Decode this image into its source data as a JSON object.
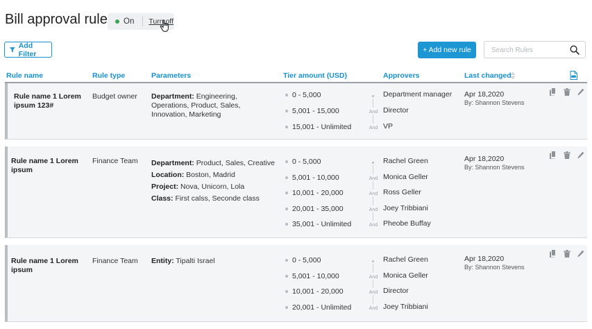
{
  "page": {
    "title": "Bill approval rules",
    "toggle": {
      "on_label": "On",
      "off_label": "Turn off",
      "status_color": "#3aa655"
    },
    "add_filter_label": "Add Filter",
    "add_rule_label": "+ Add new rule",
    "search_placeholder": "Search Rules"
  },
  "columns": {
    "rule_name": "Rule name",
    "rule_type": "Rule type",
    "parameters": "Parameters",
    "tier_amount": "Tier amount (USD)",
    "approvers": "Approvers",
    "last_changed": "Last changed"
  },
  "rules": [
    {
      "name": "Rule name 1 Lorem ipsum 123#",
      "type": "Budget owner",
      "params": [
        {
          "label": "Department:",
          "value": "Engineering, Operations, Product, Sales, Innovation, Marketing"
        }
      ],
      "tiers": [
        "0 - 5,000",
        "5,001 - 15,000",
        "15,001 - Unlimited"
      ],
      "approvers": [
        "Department manager",
        "Director",
        "VP"
      ],
      "date": "Apr 18,2020",
      "by": "By: Shannon Stevens"
    },
    {
      "name": "Rule name 1 Lorem ipsum",
      "type": "Finance Team",
      "params": [
        {
          "label": "Department:",
          "value": "Product, Sales, Creative"
        },
        {
          "label": "Location:",
          "value": "Boston, Madrid"
        },
        {
          "label": "Project:",
          "value": "Nova, Unicorn, Lola"
        },
        {
          "label": "Class:",
          "value": "First calss, Seconde class"
        }
      ],
      "tiers": [
        "0 - 5,000",
        "5,001 - 10,000",
        "10,001 - 20,000",
        "20,001 - 35,000",
        "35,001 - Unlimited"
      ],
      "approvers": [
        "Rachel Green",
        "Monica Geller",
        "Ross Geller",
        "Joey Tribbiani",
        "Pheobe Buffay"
      ],
      "date": "Apr 18,2020",
      "by": "By: Shannon Stevens"
    },
    {
      "name": "Rule name 1 Lorem ipsum",
      "type": "Finance Team",
      "params": [
        {
          "label": "Entity:",
          "value": "Tipalti Israel"
        }
      ],
      "tiers": [
        "0 - 5,000",
        "5,001 - 10,000",
        "10,001 - 20,000",
        "20,001 - Unlimited"
      ],
      "approvers": [
        "Rachel Green",
        "Monica Geller",
        "Director",
        "Joey Tribbiani"
      ],
      "date": "Apr 18,2020",
      "by": "By: Shannon Stevens"
    }
  ],
  "connector_label": "And",
  "icons": {
    "filter": "filter-icon",
    "search": "search-icon",
    "sort": "sort-icon",
    "export": "pdf-export-icon",
    "copy": "copy-icon",
    "delete": "trash-icon",
    "edit": "pencil-icon",
    "cursor": "hand-pointer-icon"
  },
  "colors": {
    "accent": "#1790d0",
    "primary_button": "#1d96d4",
    "row_bg": "#f4f5f6"
  }
}
